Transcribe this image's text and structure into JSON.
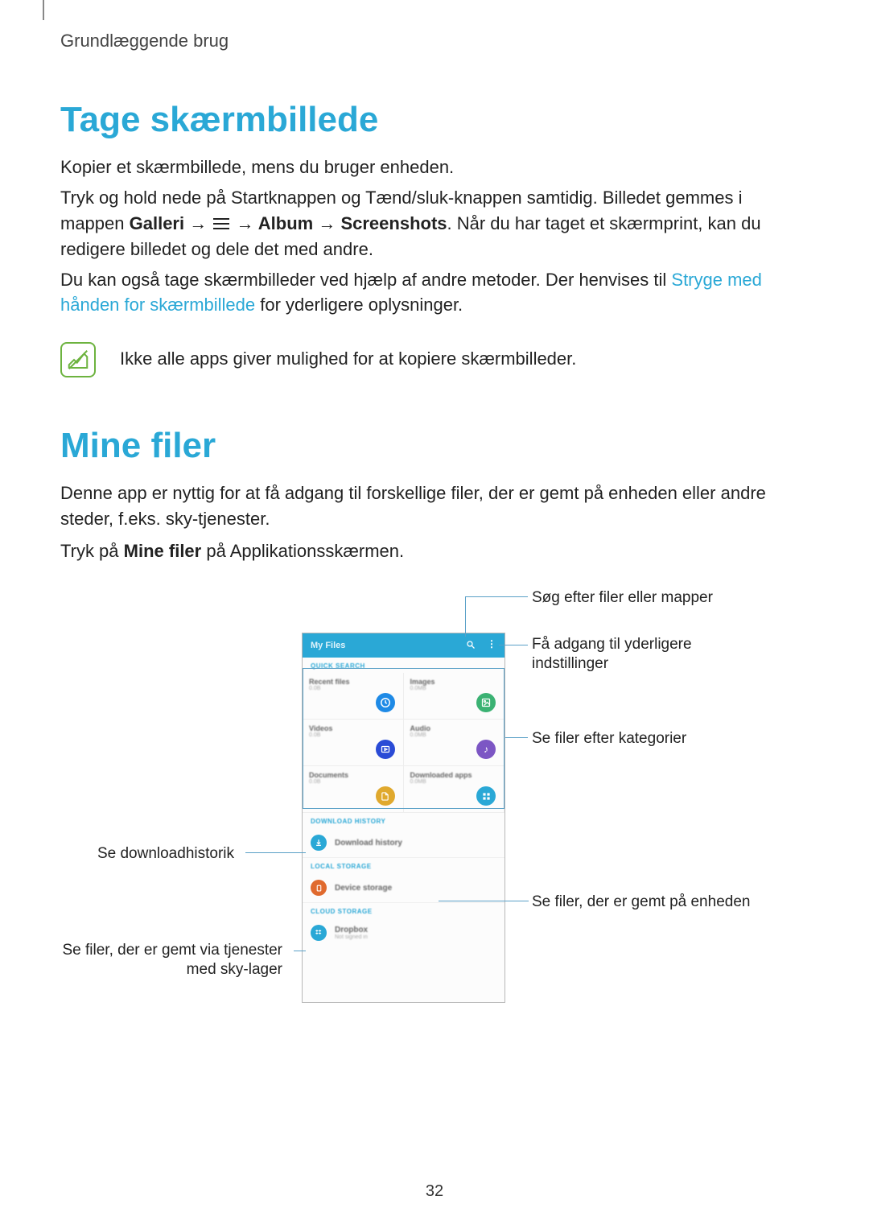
{
  "breadcrumb": "Grundlæggende brug",
  "section1": {
    "title": "Tage skærmbillede",
    "p1": "Kopier et skærmbillede, mens du bruger enheden.",
    "p2a": "Tryk og hold nede på Startknappen og Tænd/sluk-knappen samtidig. Billedet gemmes i mappen ",
    "p2_bold1": "Galleri",
    "p2_arrow": " → ",
    "p2_bold2": "Album",
    "p2_bold3": "Screenshots",
    "p2b": ". Når du har taget et skærmprint, kan du redigere billedet og dele det med andre.",
    "p3a": "Du kan også tage skærmbilleder ved hjælp af andre metoder. Der henvises til ",
    "p3_link": "Stryge med hånden for skærmbillede",
    "p3b": " for yderligere oplysninger.",
    "note": "Ikke alle apps giver mulighed for at kopiere skærmbilleder."
  },
  "section2": {
    "title": "Mine filer",
    "p1": "Denne app er nyttig for at få adgang til forskellige filer, der er gemt på enheden eller andre steder, f.eks. sky-tjenester.",
    "p2a": "Tryk på ",
    "p2_bold": "Mine filer",
    "p2b": " på Applikationsskærmen."
  },
  "callouts": {
    "search": "Søg efter filer eller mapper",
    "more": "Få adgang til yderligere indstillinger",
    "categories": "Se filer efter kategorier",
    "downloads": "Se downloadhistorik",
    "device": "Se filer, der er gemt på enheden",
    "cloud_l1": "Se filer, der er gemt via tjenester",
    "cloud_l2": "med sky-lager"
  },
  "phone": {
    "title": "My Files",
    "quick_search": "QUICK SEARCH",
    "cells": [
      {
        "title": "Recent files",
        "sub": "0.0B"
      },
      {
        "title": "Images",
        "sub": "0.0MB"
      },
      {
        "title": "Videos",
        "sub": "0.0B"
      },
      {
        "title": "Audio",
        "sub": "0.0MB"
      },
      {
        "title": "Documents",
        "sub": "0.0B"
      },
      {
        "title": "Downloaded apps",
        "sub": "0.0MB"
      }
    ],
    "download_history_label": "DOWNLOAD HISTORY",
    "download_history_item": "Download history",
    "local_storage_label": "LOCAL STORAGE",
    "device_storage_item": "Device storage",
    "cloud_storage_label": "CLOUD STORAGE",
    "dropbox_item": "Dropbox",
    "dropbox_sub": "Not signed in"
  },
  "page_number": "32"
}
